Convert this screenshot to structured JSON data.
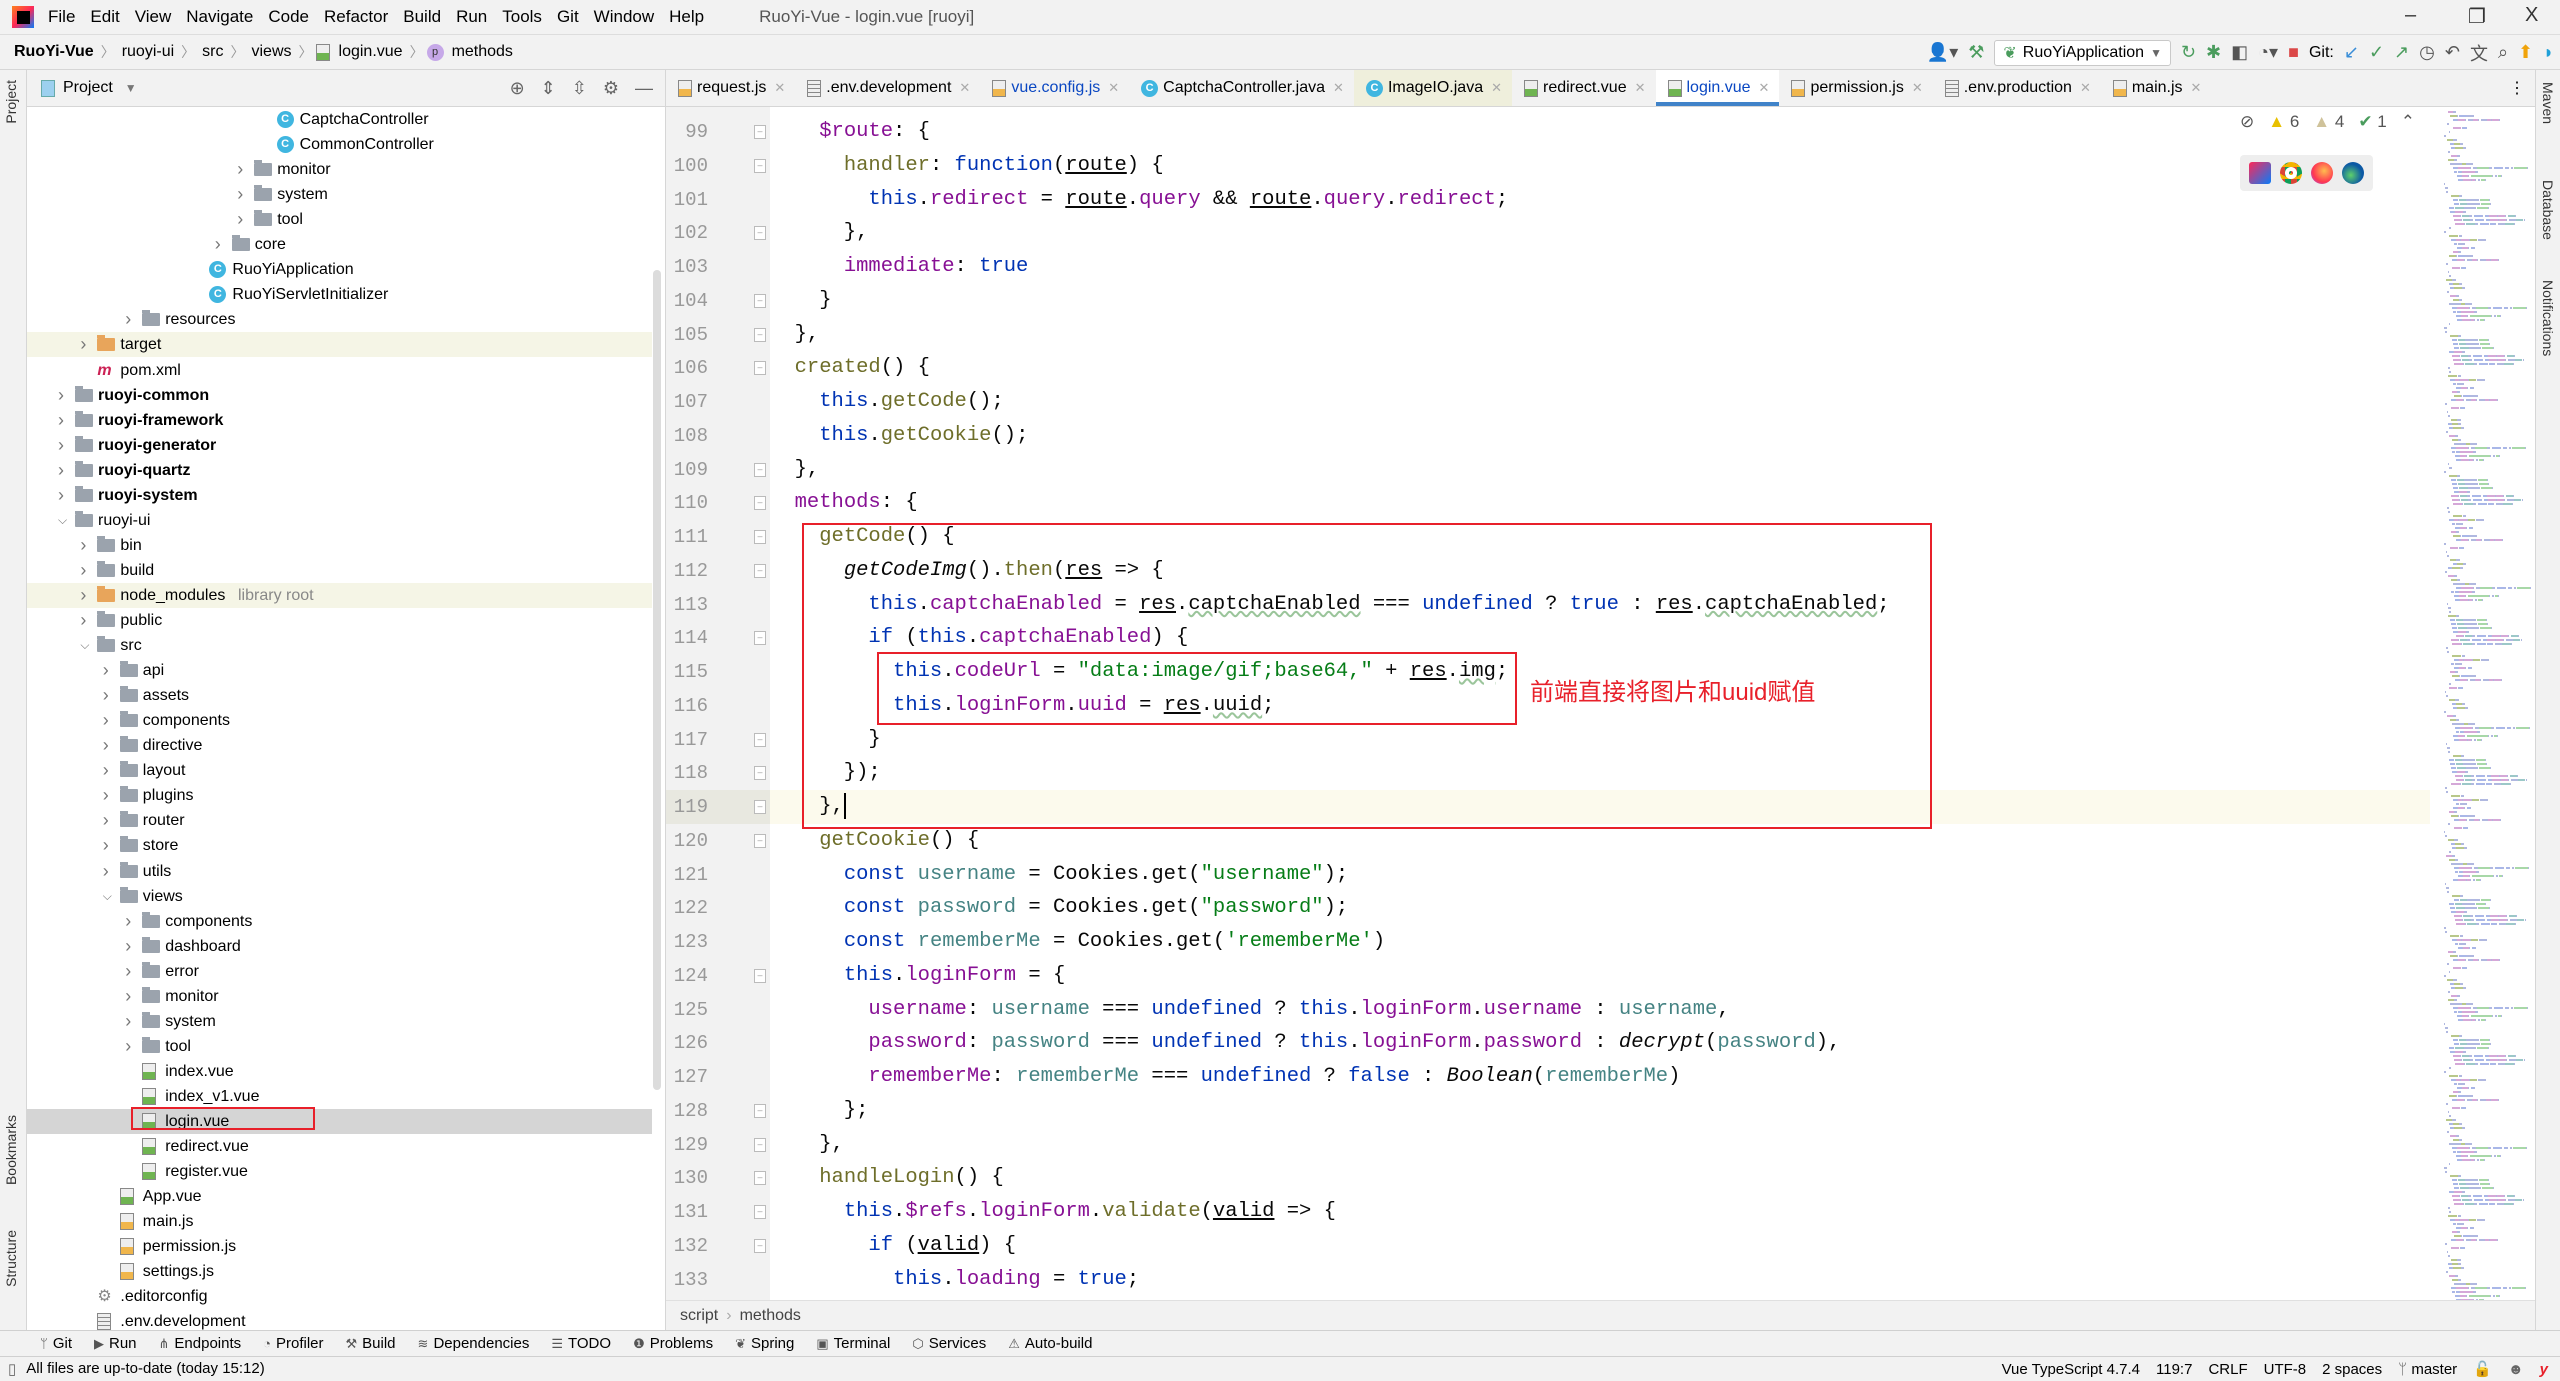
{
  "window": {
    "title": "RuoYi-Vue - login.vue [ruoyi]",
    "minimize": "–",
    "restore": "❐",
    "close": "X"
  },
  "menu": [
    "File",
    "Edit",
    "View",
    "Navigate",
    "Code",
    "Refactor",
    "Build",
    "Run",
    "Tools",
    "Git",
    "Window",
    "Help"
  ],
  "breadcrumb": [
    "RuoYi-Vue",
    "ruoyi-ui",
    "src",
    "views",
    "login.vue",
    "methods"
  ],
  "toolbar": {
    "run_config": "RuoYiApplication",
    "git_label": "Git:"
  },
  "project": {
    "title": "Project",
    "tree": [
      {
        "label": "CaptchaController",
        "level": 9,
        "kind": "class"
      },
      {
        "label": "CommonController",
        "level": 9,
        "kind": "class"
      },
      {
        "label": "monitor",
        "level": 8,
        "kind": "folder"
      },
      {
        "label": "system",
        "level": 8,
        "kind": "folder"
      },
      {
        "label": "tool",
        "level": 8,
        "kind": "folder"
      },
      {
        "label": "core",
        "level": 7,
        "kind": "folder"
      },
      {
        "label": "RuoYiApplication",
        "level": 6,
        "kind": "class"
      },
      {
        "label": "RuoYiServletInitializer",
        "level": 6,
        "kind": "class"
      },
      {
        "label": "resources",
        "level": 3,
        "kind": "folder"
      },
      {
        "label": "target",
        "level": 1,
        "kind": "folder-orange",
        "highlight": true
      },
      {
        "label": "pom.xml",
        "level": 1,
        "kind": "maven"
      },
      {
        "label": "ruoyi-common",
        "level": 0,
        "kind": "module",
        "bold": true
      },
      {
        "label": "ruoyi-framework",
        "level": 0,
        "kind": "module",
        "bold": true
      },
      {
        "label": "ruoyi-generator",
        "level": 0,
        "kind": "module",
        "bold": true
      },
      {
        "label": "ruoyi-quartz",
        "level": 0,
        "kind": "module",
        "bold": true
      },
      {
        "label": "ruoyi-system",
        "level": 0,
        "kind": "module",
        "bold": true
      },
      {
        "label": "ruoyi-ui",
        "level": 0,
        "kind": "module",
        "expanded": true
      },
      {
        "label": "bin",
        "level": 1,
        "kind": "folder"
      },
      {
        "label": "build",
        "level": 1,
        "kind": "folder"
      },
      {
        "label": "node_modules",
        "level": 1,
        "kind": "folder-orange",
        "highlight": true,
        "suffix": "library root"
      },
      {
        "label": "public",
        "level": 1,
        "kind": "folder"
      },
      {
        "label": "src",
        "level": 1,
        "kind": "folder",
        "expanded": true
      },
      {
        "label": "api",
        "level": 2,
        "kind": "folder"
      },
      {
        "label": "assets",
        "level": 2,
        "kind": "folder"
      },
      {
        "label": "components",
        "level": 2,
        "kind": "folder"
      },
      {
        "label": "directive",
        "level": 2,
        "kind": "folder"
      },
      {
        "label": "layout",
        "level": 2,
        "kind": "folder"
      },
      {
        "label": "plugins",
        "level": 2,
        "kind": "folder"
      },
      {
        "label": "router",
        "level": 2,
        "kind": "folder"
      },
      {
        "label": "store",
        "level": 2,
        "kind": "folder"
      },
      {
        "label": "utils",
        "level": 2,
        "kind": "folder"
      },
      {
        "label": "views",
        "level": 2,
        "kind": "folder",
        "expanded": true
      },
      {
        "label": "components",
        "level": 3,
        "kind": "folder"
      },
      {
        "label": "dashboard",
        "level": 3,
        "kind": "folder"
      },
      {
        "label": "error",
        "level": 3,
        "kind": "folder"
      },
      {
        "label": "monitor",
        "level": 3,
        "kind": "folder"
      },
      {
        "label": "system",
        "level": 3,
        "kind": "folder"
      },
      {
        "label": "tool",
        "level": 3,
        "kind": "folder"
      },
      {
        "label": "index.vue",
        "level": 3,
        "kind": "vue"
      },
      {
        "label": "index_v1.vue",
        "level": 3,
        "kind": "vue"
      },
      {
        "label": "login.vue",
        "level": 3,
        "kind": "vue",
        "selected": true
      },
      {
        "label": "redirect.vue",
        "level": 3,
        "kind": "vue"
      },
      {
        "label": "register.vue",
        "level": 3,
        "kind": "vue"
      },
      {
        "label": "App.vue",
        "level": 2,
        "kind": "vue"
      },
      {
        "label": "main.js",
        "level": 2,
        "kind": "js"
      },
      {
        "label": "permission.js",
        "level": 2,
        "kind": "js"
      },
      {
        "label": "settings.js",
        "level": 2,
        "kind": "js"
      },
      {
        "label": ".editorconfig",
        "level": 1,
        "kind": "gear"
      },
      {
        "label": ".env.development",
        "level": 1,
        "kind": "txt"
      }
    ]
  },
  "tabs": [
    {
      "label": "request.js",
      "icon": "js"
    },
    {
      "label": ".env.development",
      "icon": "txt"
    },
    {
      "label": "vue.config.js",
      "icon": "js",
      "modified": true
    },
    {
      "label": "CaptchaController.java",
      "icon": "class"
    },
    {
      "label": "ImageIO.java",
      "icon": "class",
      "highlight": true
    },
    {
      "label": "redirect.vue",
      "icon": "vue"
    },
    {
      "label": "login.vue",
      "icon": "vue",
      "active": true,
      "modified": true
    },
    {
      "label": "permission.js",
      "icon": "js"
    },
    {
      "label": ".env.production",
      "icon": "txt"
    },
    {
      "label": "main.js",
      "icon": "js"
    }
  ],
  "inspections": {
    "warnings": "6",
    "weak_warnings": "4",
    "typos": "1"
  },
  "editor": {
    "first_line": 99,
    "current_line": 119,
    "annotation": "前端直接将图片和uuid赋值",
    "lines": [
      [
        [
          "n",
          "    "
        ],
        [
          "p",
          "$route"
        ],
        [
          "n",
          ": {"
        ]
      ],
      [
        [
          "n",
          "      "
        ],
        [
          "f",
          "handler"
        ],
        [
          "n",
          ": "
        ],
        [
          "k",
          "function"
        ],
        [
          "n",
          "("
        ],
        [
          "u",
          "route"
        ],
        [
          "n",
          ") {"
        ]
      ],
      [
        [
          "n",
          "        "
        ],
        [
          "k",
          "this"
        ],
        [
          "n",
          "."
        ],
        [
          "p",
          "redirect"
        ],
        [
          "n",
          " = "
        ],
        [
          "u",
          "route"
        ],
        [
          "n",
          "."
        ],
        [
          "p",
          "query"
        ],
        [
          "n",
          " && "
        ],
        [
          "u",
          "route"
        ],
        [
          "n",
          "."
        ],
        [
          "p",
          "query"
        ],
        [
          "n",
          "."
        ],
        [
          "p",
          "redirect"
        ],
        [
          "n",
          ";"
        ]
      ],
      [
        [
          "n",
          "      },"
        ]
      ],
      [
        [
          "n",
          "      "
        ],
        [
          "p",
          "immediate"
        ],
        [
          "n",
          ": "
        ],
        [
          "k",
          "true"
        ]
      ],
      [
        [
          "n",
          "    }"
        ]
      ],
      [
        [
          "n",
          "  },"
        ]
      ],
      [
        [
          "n",
          "  "
        ],
        [
          "f",
          "created"
        ],
        [
          "n",
          "() {"
        ]
      ],
      [
        [
          "n",
          "    "
        ],
        [
          "k",
          "this"
        ],
        [
          "n",
          "."
        ],
        [
          "f",
          "getCode"
        ],
        [
          "n",
          "();"
        ]
      ],
      [
        [
          "n",
          "    "
        ],
        [
          "k",
          "this"
        ],
        [
          "n",
          "."
        ],
        [
          "f",
          "getCookie"
        ],
        [
          "n",
          "();"
        ]
      ],
      [
        [
          "n",
          "  },"
        ]
      ],
      [
        [
          "n",
          "  "
        ],
        [
          "p",
          "methods"
        ],
        [
          "n",
          ": {"
        ]
      ],
      [
        [
          "n",
          "    "
        ],
        [
          "f",
          "getCode"
        ],
        [
          "n",
          "() {"
        ]
      ],
      [
        [
          "n",
          "      "
        ],
        [
          "i",
          "getCodeImg"
        ],
        [
          "n",
          "()."
        ],
        [
          "f",
          "then"
        ],
        [
          "n",
          "("
        ],
        [
          "u",
          "res"
        ],
        [
          "n",
          " => {"
        ]
      ],
      [
        [
          "n",
          "        "
        ],
        [
          "k",
          "this"
        ],
        [
          "n",
          "."
        ],
        [
          "p",
          "captchaEnabled"
        ],
        [
          "n",
          " = "
        ],
        [
          "u",
          "res"
        ],
        [
          "n",
          "."
        ],
        [
          "w",
          "captchaEnabled"
        ],
        [
          "n",
          " === "
        ],
        [
          "k",
          "undefined"
        ],
        [
          "n",
          " ? "
        ],
        [
          "k",
          "true"
        ],
        [
          "n",
          " : "
        ],
        [
          "u",
          "res"
        ],
        [
          "n",
          "."
        ],
        [
          "w",
          "captchaEnabled"
        ],
        [
          "n",
          ";"
        ]
      ],
      [
        [
          "n",
          "        "
        ],
        [
          "k",
          "if"
        ],
        [
          "n",
          " ("
        ],
        [
          "k",
          "this"
        ],
        [
          "n",
          "."
        ],
        [
          "p",
          "captchaEnabled"
        ],
        [
          "n",
          ") {"
        ]
      ],
      [
        [
          "n",
          "          "
        ],
        [
          "k",
          "this"
        ],
        [
          "n",
          "."
        ],
        [
          "p",
          "codeUrl"
        ],
        [
          "n",
          " = "
        ],
        [
          "s",
          "\"data:image/gif;base64,\""
        ],
        [
          "n",
          " + "
        ],
        [
          "u",
          "res"
        ],
        [
          "n",
          "."
        ],
        [
          "w",
          "img"
        ],
        [
          "n",
          ";"
        ]
      ],
      [
        [
          "n",
          "          "
        ],
        [
          "k",
          "this"
        ],
        [
          "n",
          "."
        ],
        [
          "p",
          "loginForm"
        ],
        [
          "n",
          "."
        ],
        [
          "p",
          "uuid"
        ],
        [
          "n",
          " = "
        ],
        [
          "u",
          "res"
        ],
        [
          "n",
          "."
        ],
        [
          "w",
          "uuid"
        ],
        [
          "n",
          ";"
        ]
      ],
      [
        [
          "n",
          "        }"
        ]
      ],
      [
        [
          "n",
          "      });"
        ]
      ],
      [
        [
          "n",
          "    },"
        ]
      ],
      [
        [
          "n",
          "    "
        ],
        [
          "f",
          "getCookie"
        ],
        [
          "n",
          "() {"
        ]
      ],
      [
        [
          "n",
          "      "
        ],
        [
          "k",
          "const"
        ],
        [
          "n",
          " "
        ],
        [
          "v",
          "username"
        ],
        [
          "n",
          " = Cookies.get("
        ],
        [
          "s",
          "\"username\""
        ],
        [
          "n",
          ");"
        ]
      ],
      [
        [
          "n",
          "      "
        ],
        [
          "k",
          "const"
        ],
        [
          "n",
          " "
        ],
        [
          "v",
          "password"
        ],
        [
          "n",
          " = Cookies.get("
        ],
        [
          "s",
          "\"password\""
        ],
        [
          "n",
          ");"
        ]
      ],
      [
        [
          "n",
          "      "
        ],
        [
          "k",
          "const"
        ],
        [
          "n",
          " "
        ],
        [
          "v",
          "rememberMe"
        ],
        [
          "n",
          " = Cookies.get("
        ],
        [
          "s",
          "'rememberMe'"
        ],
        [
          "n",
          ")"
        ]
      ],
      [
        [
          "n",
          "      "
        ],
        [
          "k",
          "this"
        ],
        [
          "n",
          "."
        ],
        [
          "p",
          "loginForm"
        ],
        [
          "n",
          " = {"
        ]
      ],
      [
        [
          "n",
          "        "
        ],
        [
          "p",
          "username"
        ],
        [
          "n",
          ": "
        ],
        [
          "v",
          "username"
        ],
        [
          "n",
          " === "
        ],
        [
          "k",
          "undefined"
        ],
        [
          "n",
          " ? "
        ],
        [
          "k",
          "this"
        ],
        [
          "n",
          "."
        ],
        [
          "p",
          "loginForm"
        ],
        [
          "n",
          "."
        ],
        [
          "p",
          "username"
        ],
        [
          "n",
          " : "
        ],
        [
          "v",
          "username"
        ],
        [
          "n",
          ","
        ]
      ],
      [
        [
          "n",
          "        "
        ],
        [
          "p",
          "password"
        ],
        [
          "n",
          ": "
        ],
        [
          "v",
          "password"
        ],
        [
          "n",
          " === "
        ],
        [
          "k",
          "undefined"
        ],
        [
          "n",
          " ? "
        ],
        [
          "k",
          "this"
        ],
        [
          "n",
          "."
        ],
        [
          "p",
          "loginForm"
        ],
        [
          "n",
          "."
        ],
        [
          "p",
          "password"
        ],
        [
          "n",
          " : "
        ],
        [
          "i",
          "decrypt"
        ],
        [
          "n",
          "("
        ],
        [
          "v",
          "password"
        ],
        [
          "n",
          "),"
        ]
      ],
      [
        [
          "n",
          "        "
        ],
        [
          "p",
          "rememberMe"
        ],
        [
          "n",
          ": "
        ],
        [
          "v",
          "rememberMe"
        ],
        [
          "n",
          " === "
        ],
        [
          "k",
          "undefined"
        ],
        [
          "n",
          " ? "
        ],
        [
          "k",
          "false"
        ],
        [
          "n",
          " : "
        ],
        [
          "i",
          "Boolean"
        ],
        [
          "n",
          "("
        ],
        [
          "v",
          "rememberMe"
        ],
        [
          "n",
          ")"
        ]
      ],
      [
        [
          "n",
          "      };"
        ]
      ],
      [
        [
          "n",
          "    },"
        ]
      ],
      [
        [
          "n",
          "    "
        ],
        [
          "f",
          "handleLogin"
        ],
        [
          "n",
          "() {"
        ]
      ],
      [
        [
          "n",
          "      "
        ],
        [
          "k",
          "this"
        ],
        [
          "n",
          "."
        ],
        [
          "p",
          "$refs"
        ],
        [
          "n",
          "."
        ],
        [
          "p",
          "loginForm"
        ],
        [
          "n",
          "."
        ],
        [
          "f",
          "validate"
        ],
        [
          "n",
          "("
        ],
        [
          "u",
          "valid"
        ],
        [
          "n",
          " => {"
        ]
      ],
      [
        [
          "n",
          "        "
        ],
        [
          "k",
          "if"
        ],
        [
          "n",
          " ("
        ],
        [
          "u",
          "valid"
        ],
        [
          "n",
          ") {"
        ]
      ],
      [
        [
          "n",
          "          "
        ],
        [
          "k",
          "this"
        ],
        [
          "n",
          "."
        ],
        [
          "p",
          "loading"
        ],
        [
          "n",
          " = "
        ],
        [
          "k",
          "true"
        ],
        [
          "n",
          ";"
        ]
      ]
    ]
  },
  "editor_breadcrumb": [
    "script",
    "methods"
  ],
  "tool_windows": [
    "Git",
    "Run",
    "Endpoints",
    "Profiler",
    "Build",
    "Dependencies",
    "TODO",
    "Problems",
    "Spring",
    "Terminal",
    "Services",
    "Auto-build"
  ],
  "side_labels": {
    "left": [
      "Project",
      "Bookmarks",
      "Structure"
    ],
    "right": [
      "Maven",
      "Database",
      "Notifications"
    ]
  },
  "status": {
    "message": "All files are up-to-date (today 15:12)",
    "language": "Vue TypeScript 4.7.4",
    "position": "119:7",
    "line_sep": "CRLF",
    "encoding": "UTF-8",
    "indent": "2 spaces",
    "branch": "master"
  },
  "colors": {
    "accent": "#4083c9",
    "annotation_red": "#e8202a",
    "current_line": "#fcfaed"
  }
}
